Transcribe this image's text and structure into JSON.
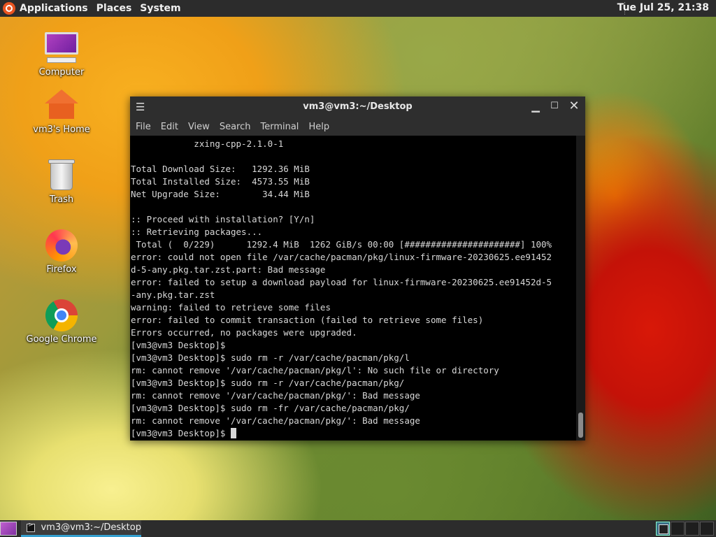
{
  "top_panel": {
    "menus": [
      "Applications",
      "Places",
      "System"
    ],
    "clock": "Tue Jul 25, 21:38",
    "logo_icon": "ubuntu-logo-icon"
  },
  "desktop_icons": [
    {
      "label": "Computer",
      "icon": "computer-icon"
    },
    {
      "label": "vm3's Home",
      "icon": "home-folder-icon"
    },
    {
      "label": "Trash",
      "icon": "trash-icon"
    },
    {
      "label": "Firefox",
      "icon": "firefox-icon"
    },
    {
      "label": "Google Chrome",
      "icon": "chrome-icon"
    }
  ],
  "terminal": {
    "title": "vm3@vm3:~/Desktop",
    "menu": [
      "File",
      "Edit",
      "View",
      "Search",
      "Terminal",
      "Help"
    ],
    "lines": [
      "            zxing-cpp-2.1.0-1",
      "",
      "Total Download Size:   1292.36 MiB",
      "Total Installed Size:  4573.55 MiB",
      "Net Upgrade Size:        34.44 MiB",
      "",
      ":: Proceed with installation? [Y/n]",
      ":: Retrieving packages...",
      " Total (  0/229)      1292.4 MiB  1262 GiB/s 00:00 [######################] 100%",
      "error: could not open file /var/cache/pacman/pkg/linux-firmware-20230625.ee91452",
      "d-5-any.pkg.tar.zst.part: Bad message",
      "error: failed to setup a download payload for linux-firmware-20230625.ee91452d-5",
      "-any.pkg.tar.zst",
      "warning: failed to retrieve some files",
      "error: failed to commit transaction (failed to retrieve some files)",
      "Errors occurred, no packages were upgraded.",
      "[vm3@vm3 Desktop]$",
      "[vm3@vm3 Desktop]$ sudo rm -r /var/cache/pacman/pkg/l",
      "rm: cannot remove '/var/cache/pacman/pkg/l': No such file or directory",
      "[vm3@vm3 Desktop]$ sudo rm -r /var/cache/pacman/pkg/",
      "rm: cannot remove '/var/cache/pacman/pkg/': Bad message",
      "[vm3@vm3 Desktop]$ sudo rm -fr /var/cache/pacman/pkg/",
      "rm: cannot remove '/var/cache/pacman/pkg/': Bad message"
    ],
    "prompt": "[vm3@vm3 Desktop]$ "
  },
  "taskbar": {
    "task_label": "vm3@vm3:~/Desktop",
    "workspaces": 4,
    "active_workspace": 1
  }
}
